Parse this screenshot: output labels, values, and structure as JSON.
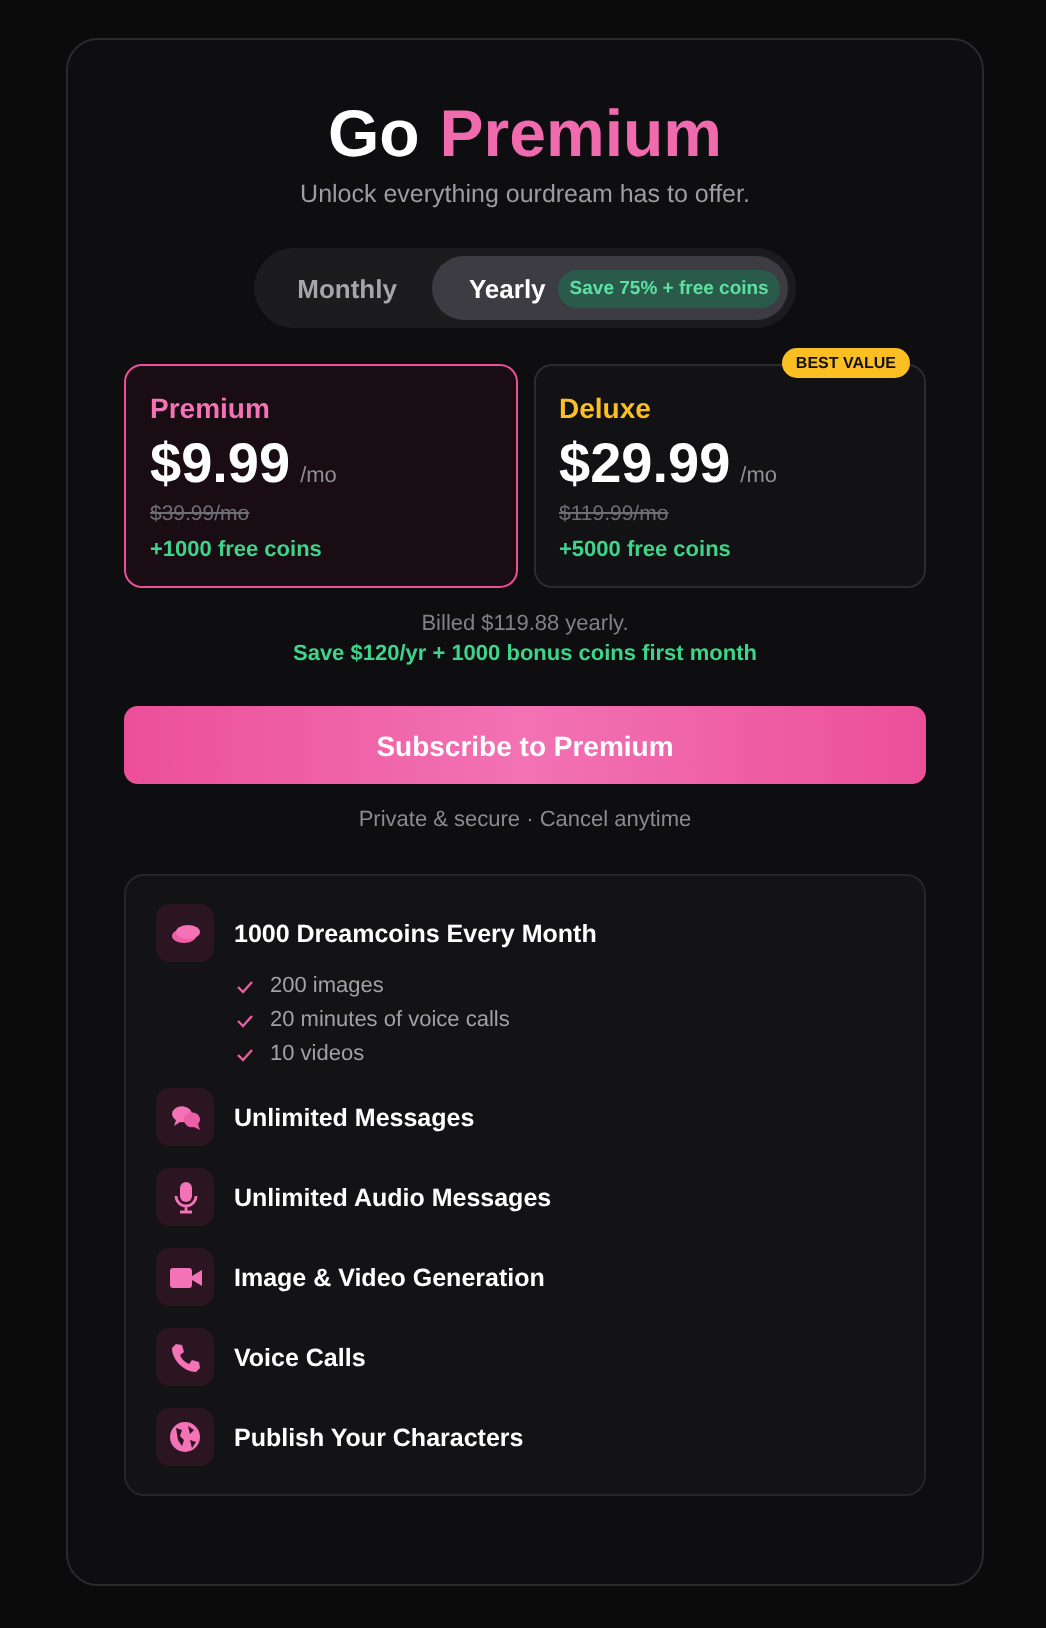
{
  "title": {
    "lead": "Go",
    "accent": "Premium"
  },
  "subtitle": "Unlock everything ourdream has to offer.",
  "billing_tabs": [
    {
      "label": "Monthly",
      "selected": false
    },
    {
      "label": "Yearly",
      "selected": true,
      "badge": "Save 75% + free coins"
    }
  ],
  "plans": [
    {
      "name": "Premium",
      "color": "#f472b6",
      "selected": true,
      "price": "$9.99",
      "unit": "/mo",
      "old_price": "$39.99/mo",
      "coins": "+1000 free coins"
    },
    {
      "name": "Deluxe",
      "color": "#fbbf24",
      "selected": false,
      "badge": "BEST VALUE",
      "price": "$29.99",
      "unit": "/mo",
      "old_price": "$119.99/mo",
      "coins": "+5000 free coins"
    }
  ],
  "billing_note": "Billed $119.88 yearly.",
  "savings_note": "Save $120/yr + 1000 bonus coins first month",
  "subscribe_button": "Subscribe to Premium",
  "security_note": "Private & secure · Cancel anytime",
  "features": [
    {
      "kind": "coins",
      "label": "1000 Dreamcoins Every Month",
      "details": [
        "200 images",
        "20 minutes of voice calls",
        "10 videos"
      ]
    },
    {
      "kind": "chat",
      "label": "Unlimited Messages"
    },
    {
      "kind": "mic",
      "label": "Unlimited Audio Messages"
    },
    {
      "kind": "video",
      "label": "Image & Video Generation"
    },
    {
      "kind": "phone",
      "label": "Voice Calls"
    },
    {
      "kind": "globe",
      "label": "Publish Your Characters"
    }
  ]
}
